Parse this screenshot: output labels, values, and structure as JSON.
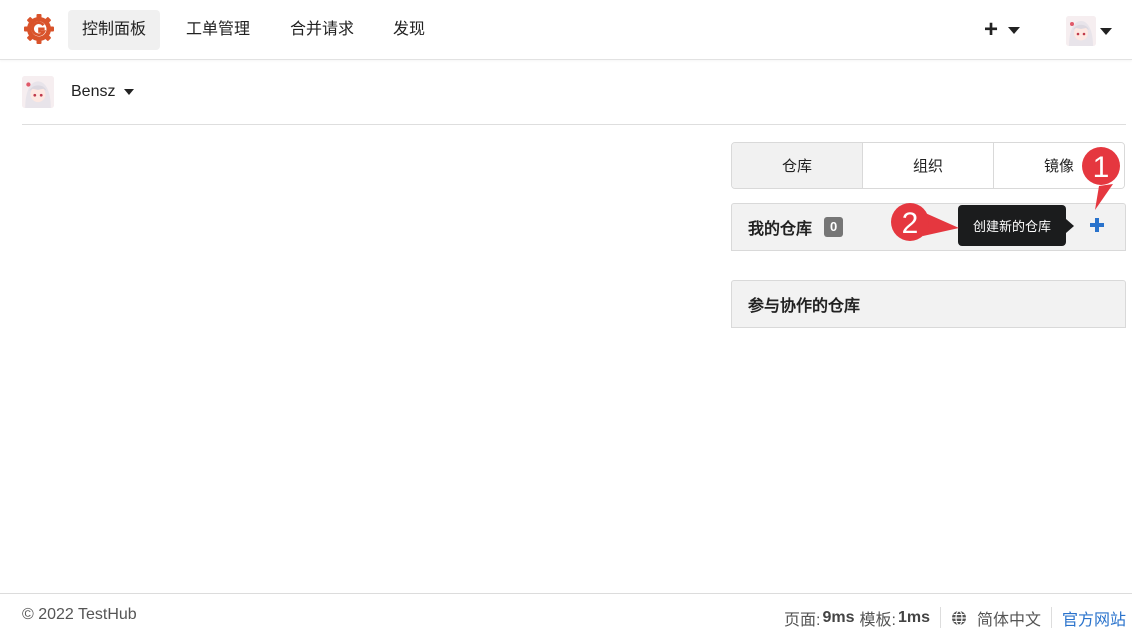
{
  "colors": {
    "accent": "#2a73cc",
    "brand": "#d9532b",
    "annotation": "#e5373f",
    "tooltip_bg": "#1b1c1d"
  },
  "nav": {
    "items": [
      {
        "label": "控制面板",
        "active": true
      },
      {
        "label": "工单管理"
      },
      {
        "label": "合并请求"
      },
      {
        "label": "发现"
      }
    ],
    "plus_icon": "plus-icon"
  },
  "context": {
    "user": "Bensz"
  },
  "tabs": [
    {
      "label": "仓库"
    },
    {
      "label": "组织"
    },
    {
      "label": "镜像"
    }
  ],
  "my_repos": {
    "title": "我的仓库",
    "count": "0"
  },
  "tooltip": {
    "text": "创建新的仓库"
  },
  "collab_repos": {
    "title": "参与协作的仓库"
  },
  "annotations": {
    "one": "1",
    "two": "2"
  },
  "footer": {
    "copyright": "© 2022 TestHub",
    "page_label": "页面:",
    "page_time": "9ms",
    "template_label": "模板:",
    "template_time": "1ms",
    "language": "简体中文",
    "official_site": "官方网站"
  }
}
